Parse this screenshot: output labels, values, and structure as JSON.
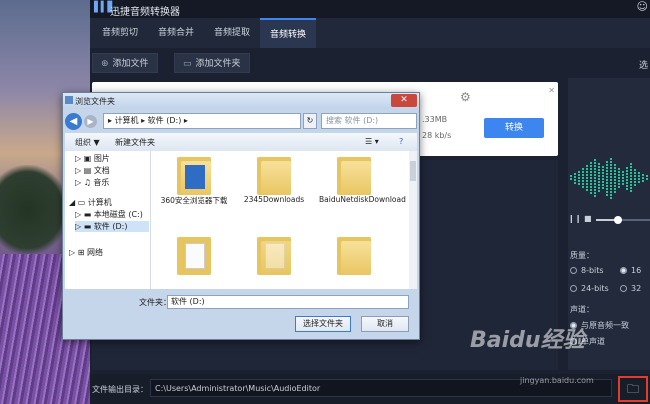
{
  "app": {
    "title": "迅捷音频转换器",
    "tabs": [
      "音频剪切",
      "音频合并",
      "音频提取",
      "音频转换"
    ],
    "active_tab_index": 3,
    "toolbar": {
      "add_file": "添加文件",
      "add_folder": "添加文件夹",
      "right_label": "选"
    },
    "card": {
      "size": ".33MB",
      "rate": "28 kb/s",
      "convert": "转换"
    },
    "settings": {
      "quality_label": "质量：",
      "bits": [
        "8-bits",
        "16",
        "24-bits",
        "32"
      ],
      "channel_label": "声道：",
      "channel_options": [
        "与原音频一致",
        "单声道"
      ]
    },
    "output": {
      "label": "文件输出目录：",
      "path": "C:\\Users\\Administrator\\Music\\AudioEditor"
    }
  },
  "dialog": {
    "title": "浏览文件夹",
    "address": [
      "计算机",
      "软件 (D:)"
    ],
    "search_placeholder": "搜索 软件 (D:)",
    "commands": {
      "organize": "组织 ▼",
      "new_folder": "新建文件夹"
    },
    "tree": [
      "图片",
      "文档",
      "音乐",
      "计算机",
      "本地磁盘 (C:)",
      "软件 (D:)",
      "网络"
    ],
    "files": [
      {
        "name": "360安全浏览器下载"
      },
      {
        "name": "2345Downloads"
      },
      {
        "name": "BaiduNetdiskDownload"
      },
      {
        "name": ""
      },
      {
        "name": ""
      },
      {
        "name": ""
      }
    ],
    "folder_label": "文件夹：",
    "folder_value": "软件 (D:)",
    "select_button": "选择文件夹",
    "cancel_button": "取消"
  },
  "watermark": {
    "text": "Baidu经验",
    "url": "jingyan.baidu.com"
  }
}
